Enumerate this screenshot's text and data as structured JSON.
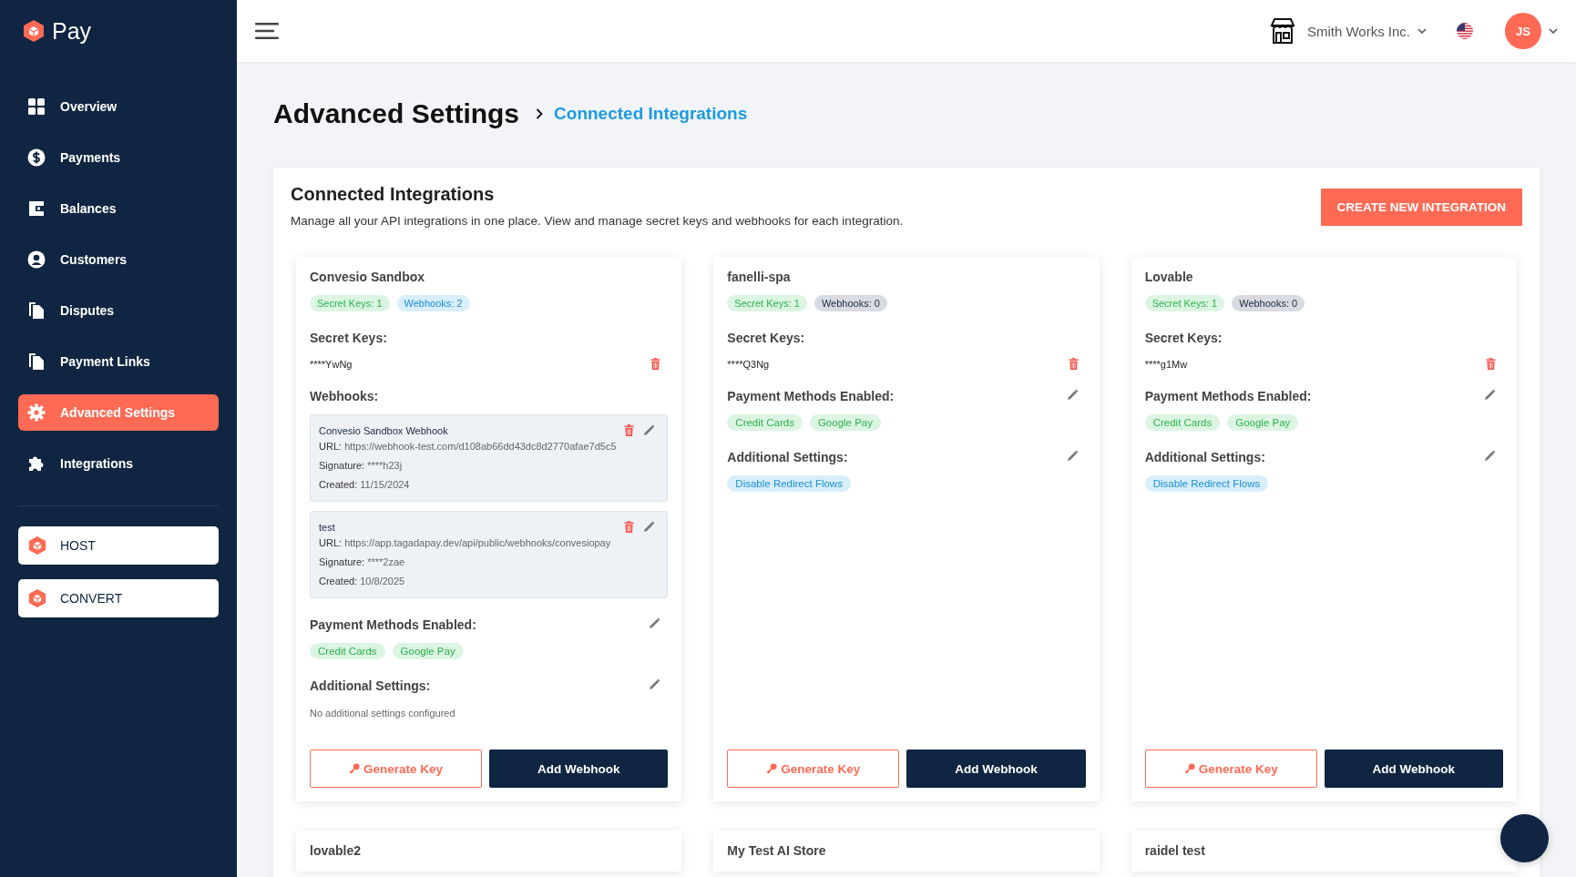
{
  "brand": {
    "name": "Pay"
  },
  "sidebar": {
    "items": [
      {
        "label": "Overview",
        "kind": "grid",
        "selected": false
      },
      {
        "label": "Payments",
        "kind": "dollar",
        "selected": false
      },
      {
        "label": "Balances",
        "kind": "wallet",
        "selected": false
      },
      {
        "label": "Customers",
        "kind": "user",
        "selected": false
      },
      {
        "label": "Disputes",
        "kind": "docs",
        "selected": false
      },
      {
        "label": "Payment Links",
        "kind": "docs",
        "selected": false
      },
      {
        "label": "Advanced Settings",
        "kind": "gear",
        "selected": true
      },
      {
        "label": "Integrations",
        "kind": "puzzle",
        "selected": false
      }
    ],
    "apps": [
      {
        "label": "HOST"
      },
      {
        "label": "CONVERT"
      }
    ]
  },
  "header": {
    "merchant": "Smith Works Inc.",
    "avatar_initials": "JS"
  },
  "page": {
    "title": "Advanced Settings",
    "breadcrumb": "Connected Integrations"
  },
  "panel": {
    "title": "Connected Integrations",
    "description": "Manage all your API integrations in one place. View and manage secret keys and webhooks for each integration.",
    "create_button": "CREATE NEW INTEGRATION"
  },
  "integrations": [
    {
      "name": "Convesio Sandbox",
      "badges": [
        {
          "text": "Secret Keys: 1",
          "kind": "success"
        },
        {
          "text": "Webhooks: 2",
          "kind": "info"
        }
      ],
      "secret_keys_label": "Secret Keys:",
      "secret_keys": [
        "****YwNg"
      ],
      "webhooks_label": "Webhooks:",
      "webhooks": [
        {
          "name": "Convesio Sandbox Webhook",
          "url_label": "URL:",
          "url": "https://webhook-test.com/d108ab66dd43dc8d2770afae7d5c5",
          "signature_label": "Signature:",
          "signature": "****h23j",
          "created_label": "Created:",
          "created": "11/15/2024"
        },
        {
          "name": "test",
          "url_label": "URL:",
          "url": "https://app.tagadapay.dev/api/public/webhooks/convesiopay",
          "signature_label": "Signature:",
          "signature": "****2zae",
          "created_label": "Created:",
          "created": "10/8/2025"
        }
      ],
      "payment_label": "Payment Methods Enabled:",
      "payment_methods": [
        "Credit Cards",
        "Google Pay"
      ],
      "settings_label": "Additional Settings:",
      "settings_empty": "No additional settings configured",
      "generate_button": "Generate Key",
      "webhook_button": "Add Webhook"
    },
    {
      "name": "fanelli-spa",
      "badges": [
        {
          "text": "Secret Keys: 1",
          "kind": "success"
        },
        {
          "text": "Webhooks: 0",
          "kind": "neutral"
        }
      ],
      "secret_keys_label": "Secret Keys:",
      "secret_keys": [
        "****Q3Ng"
      ],
      "payment_label": "Payment Methods Enabled:",
      "payment_methods": [
        "Credit Cards",
        "Google Pay"
      ],
      "settings_label": "Additional Settings:",
      "settings": [
        "Disable Redirect Flows"
      ],
      "generate_button": "Generate Key",
      "webhook_button": "Add Webhook"
    },
    {
      "name": "Lovable",
      "badges": [
        {
          "text": "Secret Keys: 1",
          "kind": "success"
        },
        {
          "text": "Webhooks: 0",
          "kind": "neutral"
        }
      ],
      "secret_keys_label": "Secret Keys:",
      "secret_keys": [
        "****g1Mw"
      ],
      "payment_label": "Payment Methods Enabled:",
      "payment_methods": [
        "Credit Cards",
        "Google Pay"
      ],
      "settings_label": "Additional Settings:",
      "settings": [
        "Disable Redirect Flows"
      ],
      "generate_button": "Generate Key",
      "webhook_button": "Add Webhook"
    },
    {
      "name": "lovable2"
    },
    {
      "name": "My Test AI Store"
    },
    {
      "name": "raidel test"
    }
  ]
}
